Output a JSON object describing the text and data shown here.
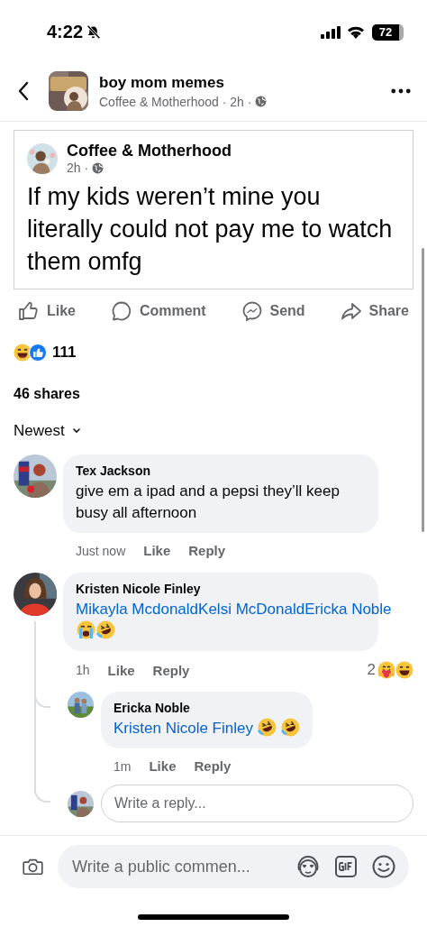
{
  "status_bar": {
    "time": "4:22",
    "battery": "72"
  },
  "header": {
    "title": "boy mom memes",
    "meta": "Coffee & Motherhood · 2h ·"
  },
  "post": {
    "author": "Coffee & Motherhood",
    "meta": "2h ·",
    "text": "If my kids weren’t mine you literally could not pay me to watch them omfg"
  },
  "actions": [
    {
      "kind": "like",
      "label": "Like"
    },
    {
      "kind": "comment",
      "label": "Comment"
    },
    {
      "kind": "send",
      "label": "Send"
    },
    {
      "kind": "share",
      "label": "Share"
    }
  ],
  "reactions": {
    "count": "111",
    "icons": [
      {
        "kind": "haha"
      },
      {
        "kind": "like"
      }
    ]
  },
  "shares": "46 shares",
  "sort": "Newest",
  "comments": [
    {
      "author": "Tex Jackson",
      "text": "give em a ipad and a pepsi they’ll keep busy all afternoon",
      "time": "Just now",
      "like": "Like",
      "reply": "Reply"
    },
    {
      "author": "Kristen Nicole Finley",
      "mentions": [
        "Mikayla Mcdonald",
        "Kelsi McDonald",
        "Ericka Noble"
      ],
      "emojis": [
        {
          "kind": "crying"
        },
        {
          "kind": "rofl"
        }
      ],
      "time": "1h",
      "like": "Like",
      "reply": "Reply",
      "reaction_count": "2",
      "reaction_icons": [
        {
          "kind": "care"
        },
        {
          "kind": "haha"
        }
      ],
      "replies": [
        {
          "author": "Ericka Noble",
          "mentions": [
            "Kristen Nicole Finley"
          ],
          "emojis": [
            {
              "kind": "rofl"
            },
            {
              "kind": "rofl"
            }
          ],
          "time": "1m",
          "like": "Like",
          "reply": "Reply"
        }
      ],
      "reply_placeholder": "Write a reply..."
    }
  ],
  "composer": {
    "placeholder": "Write a public commen..."
  }
}
